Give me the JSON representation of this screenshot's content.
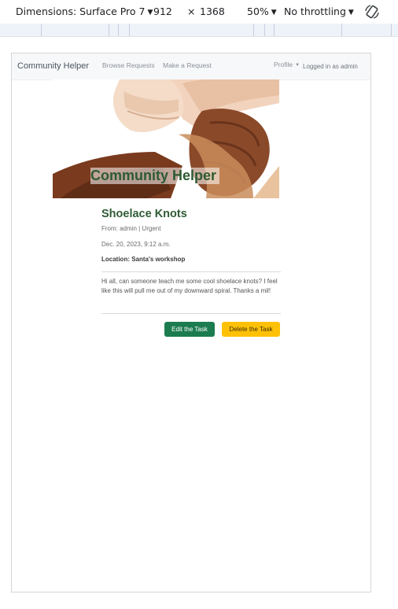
{
  "devtools": {
    "dimensions_label": "Dimensions: Surface Pro 7",
    "width": "912",
    "times": "×",
    "height": "1368",
    "zoom": "50%",
    "throttling": "No throttling"
  },
  "navbar": {
    "brand": "Community Helper",
    "links": [
      "Browse Requests",
      "Make a Request"
    ],
    "profile": "Profile",
    "logged_in": "Logged in as admin"
  },
  "hero": {
    "title": "Community Helper"
  },
  "task": {
    "title": "Shoelace Knots",
    "from_line": "From: admin | Urgent",
    "date": "Dec. 20, 2023, 9:12 a.m.",
    "location": "Location: Santa's workshop",
    "description": "Hi all, can someone teach me some cool shoelace knots? I feel like this will pull me out of my downward spiral. Thanks a mil!",
    "edit_label": "Edit the Task",
    "delete_label": "Delete the Task"
  },
  "colors": {
    "brand_green": "#2f5b35",
    "edit_button": "#1c7c4f",
    "delete_button": "#ffc107"
  }
}
